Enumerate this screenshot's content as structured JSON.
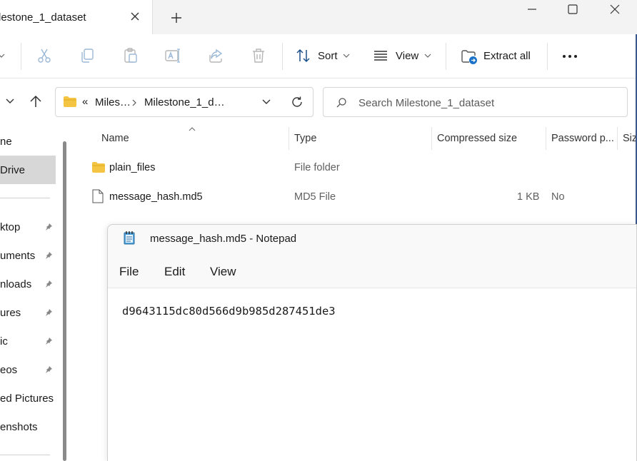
{
  "tab": {
    "title": "lestone_1_dataset"
  },
  "toolbar": {
    "sort_label": "Sort",
    "view_label": "View",
    "extract_label": "Extract all"
  },
  "address": {
    "overflow": "«",
    "crumb1": "Miles…",
    "crumb2": "Milestone_1_d…"
  },
  "search": {
    "placeholder": "Search Milestone_1_dataset"
  },
  "sidebar": {
    "items": [
      {
        "label": "ne"
      },
      {
        "label": "Drive"
      },
      {
        "label": "ktop"
      },
      {
        "label": "uments"
      },
      {
        "label": "nloads"
      },
      {
        "label": "ures"
      },
      {
        "label": "ic"
      },
      {
        "label": "eos"
      },
      {
        "label": "ed Pictures"
      },
      {
        "label": "enshots"
      }
    ]
  },
  "columns": {
    "name": "Name",
    "type": "Type",
    "compressed_size": "Compressed size",
    "password": "Password p...",
    "size": "Siz"
  },
  "files": [
    {
      "name": "plain_files",
      "type": "File folder",
      "compressed_size": "",
      "password": ""
    },
    {
      "name": "message_hash.md5",
      "type": "MD5 File",
      "compressed_size": "1 KB",
      "password": "No"
    }
  ],
  "notepad": {
    "title": "message_hash.md5 - Notepad",
    "menu": {
      "file": "File",
      "edit": "Edit",
      "view": "View"
    },
    "content": "d9643115dc80d566d9b985d287451de3"
  },
  "colors": {
    "folder": "#f4c542",
    "accent": "#1a73c8",
    "notepad_icon": "#2f88c9"
  }
}
